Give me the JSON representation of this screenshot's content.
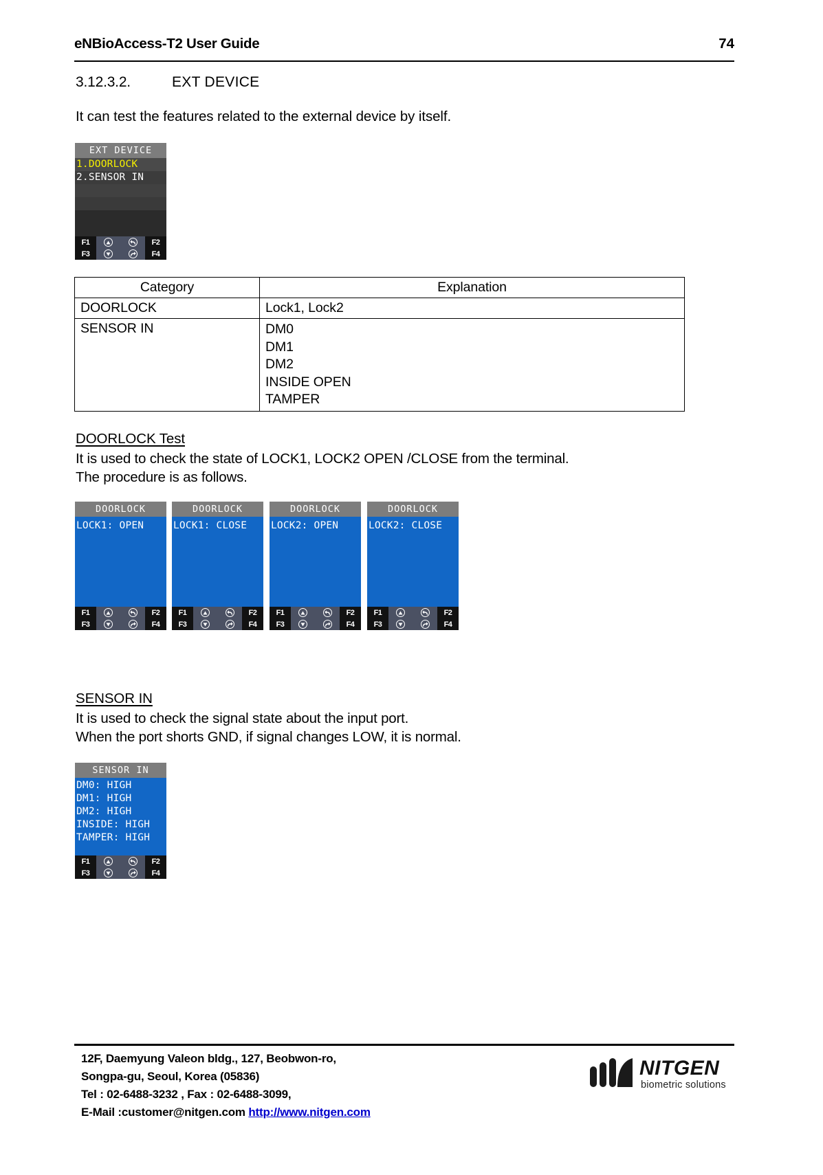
{
  "header": {
    "title": "eNBioAccess-T2 User Guide",
    "page_number": "74"
  },
  "section": {
    "number": "3.12.3.2.",
    "title": "EXT DEVICE",
    "intro": "It can test the features related to the external device by itself."
  },
  "ext_device_screen": {
    "title": "EXT DEVICE",
    "items": [
      {
        "label": "1.DOORLOCK",
        "selected": true
      },
      {
        "label": "2.SENSOR IN",
        "selected": false
      }
    ],
    "keys": {
      "f1": "F1",
      "f2": "F2",
      "f3": "F3",
      "f4": "F4",
      "up_icon": "arrow-up-icon",
      "down_icon": "arrow-down-icon",
      "back_icon": "arrow-back-icon",
      "enter_icon": "arrow-enter-icon"
    }
  },
  "table": {
    "headers": [
      "Category",
      "Explanation"
    ],
    "rows": [
      {
        "category": "DOORLOCK",
        "explanation": [
          "Lock1, Lock2"
        ]
      },
      {
        "category": "SENSOR IN",
        "explanation": [
          "DM0",
          "DM1",
          "DM2",
          "INSIDE OPEN",
          "TAMPER"
        ]
      }
    ]
  },
  "doorlock_section": {
    "heading": "DOORLOCK Test",
    "line1": "It is used to check the state of LOCK1, LOCK2 OPEN /CLOSE from the terminal.",
    "line2": "The procedure is as follows."
  },
  "doorlock_screens": [
    {
      "title": "DOORLOCK",
      "status": "LOCK1: OPEN"
    },
    {
      "title": "DOORLOCK",
      "status": "LOCK1: CLOSE"
    },
    {
      "title": "DOORLOCK",
      "status": "LOCK2: OPEN"
    },
    {
      "title": "DOORLOCK",
      "status": "LOCK2: CLOSE"
    }
  ],
  "sensor_section": {
    "heading": "SENSOR IN",
    "line1": "It is used to check the signal state about the input port.",
    "line2": "When the port shorts GND, if signal changes LOW, it is normal."
  },
  "sensor_screen": {
    "title": "SENSOR IN",
    "rows": [
      "DM0: HIGH",
      "DM1: HIGH",
      "DM2: HIGH",
      "INSIDE: HIGH",
      "TAMPER: HIGH"
    ]
  },
  "keys": {
    "f1": "F1",
    "f2": "F2",
    "f3": "F3",
    "f4": "F4"
  },
  "footer": {
    "line1": "12F, Daemyung Valeon bldg., 127, Beobwon-ro,",
    "line2": "Songpa-gu, Seoul, Korea (05836)",
    "line3": "Tel : 02-6488-3232 , Fax : 02-6488-3099,",
    "line4_label": "E-Mail :customer@nitgen.com ",
    "line4_link": "http://www.nitgen.com",
    "logo_name": "NITGEN",
    "logo_tagline": "biometric solutions"
  },
  "colors": {
    "screen_blue": "#1267c6",
    "screen_titlebar": "#7d7d7d",
    "selected_yellow": "#f5f000",
    "link_blue": "#0000cc"
  }
}
